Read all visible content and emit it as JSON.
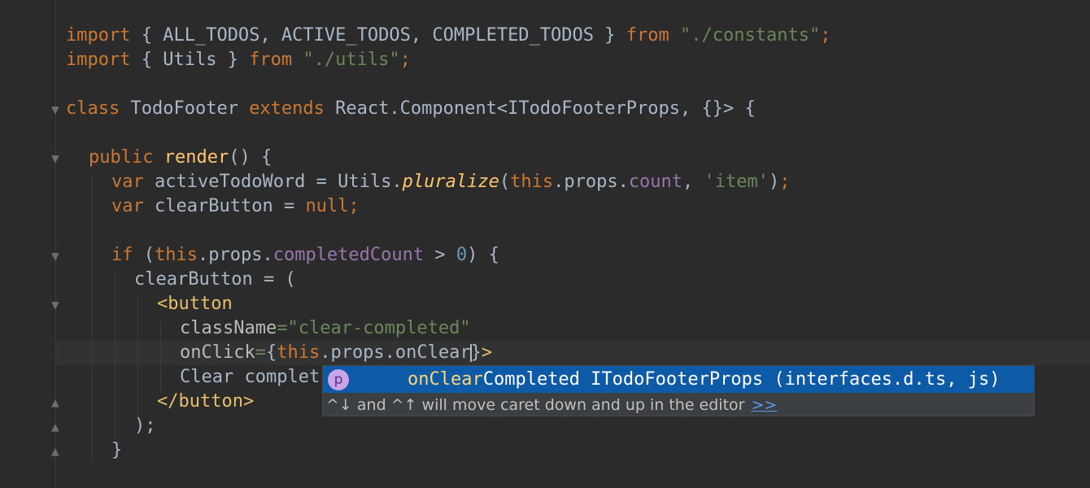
{
  "code": {
    "line1": {
      "kw1": "import",
      "t1": " { ALL_TODOS, ACTIVE_TODOS, COMPLETED_TODOS } ",
      "kw2": "from",
      "t2": " ",
      "str": "\"./constants\"",
      "semi": ";"
    },
    "line2": {
      "kw1": "import",
      "t1": " { Utils } ",
      "kw2": "from",
      "t2": " ",
      "str": "\"./utils\"",
      "semi": ";"
    },
    "line4": {
      "kw1": "class",
      "t1": " TodoFooter ",
      "kw2": "extends",
      "t2": " React.Component<ITodoFooterProps, {}> {"
    },
    "line6": {
      "kw": "public",
      "sp": " ",
      "fn": "render",
      "t": "() {"
    },
    "line7": {
      "kw": "var",
      "t1": " activeTodoWord = Utils.",
      "fn": "pluralize",
      "t2": "(",
      "kw2": "this",
      "t3": ".props.",
      "prop": "count",
      "t4": ", ",
      "str": "'item'",
      "t5": ")",
      "semi": ";"
    },
    "line8": {
      "kw": "var",
      "t1": " clearButton = ",
      "kw2": "null",
      "semi": ";"
    },
    "line10": {
      "kw": "if",
      "t1": " (",
      "kw2": "this",
      "t2": ".props.",
      "prop": "completedCount",
      "t3": " > ",
      "num": "0",
      "t4": ") {"
    },
    "line11": {
      "t": "clearButton = ("
    },
    "line12": {
      "tag": "<button"
    },
    "line13": {
      "attr": "className",
      "eq": "=",
      "str": "\"clear-completed\""
    },
    "line14": {
      "attr": "onClick",
      "eq": "=",
      "t1": "{",
      "kw": "this",
      "t2": ".props.onClear",
      "t3": "}",
      "tag": ">"
    },
    "line15": {
      "t": "Clear complet"
    },
    "line16": {
      "tag": "</button>"
    },
    "line17": {
      "t": ");"
    },
    "line18": {
      "t": "}"
    }
  },
  "autocomplete": {
    "badge": "p",
    "match": "onClear",
    "rest": "Completed ITodoFooterProps (interfaces.d.ts, js)",
    "hint": "^↓ and ^↑ will move caret down and up in the editor",
    "hint_link": ">>"
  }
}
